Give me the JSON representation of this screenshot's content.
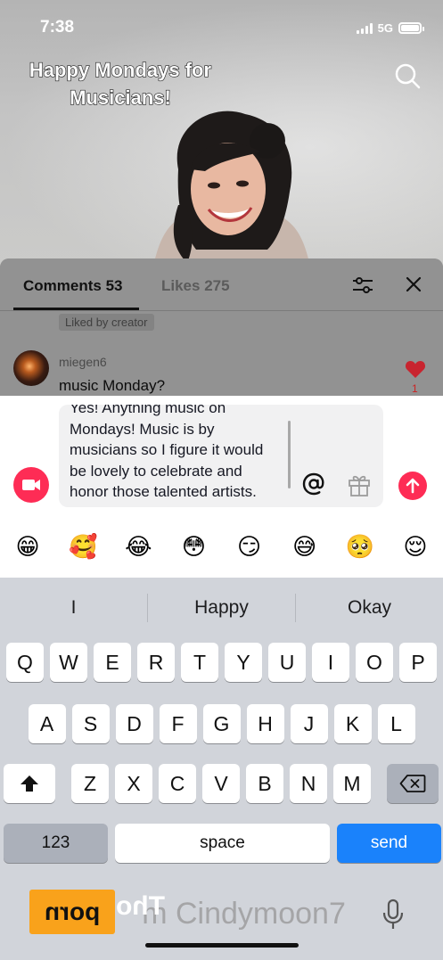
{
  "status": {
    "time": "7:38",
    "network": "5G"
  },
  "video": {
    "title_line1": "Happy Mondays for",
    "title_line2": "Musicians!"
  },
  "comments_sheet": {
    "tab_comments": "Comments 53",
    "tab_likes": "Likes 275",
    "liked_by_creator": "Liked by creator",
    "comment": {
      "username": "miegen6",
      "text": "music Monday?",
      "likes": "1"
    }
  },
  "composer": {
    "lines": [
      "Yes! Anything music on",
      "Mondays! Music is by",
      "musicians so I figure it would",
      "be lovely to celebrate and",
      "honor those talented artists."
    ]
  },
  "emojis": [
    "😁",
    "🥰",
    "😂",
    "😳",
    "😏",
    "😅",
    "🥺",
    "😌"
  ],
  "keyboard": {
    "suggestions": [
      "I",
      "Happy",
      "Okay"
    ],
    "row1": [
      "Q",
      "W",
      "E",
      "R",
      "T",
      "Y",
      "U",
      "I",
      "O",
      "P"
    ],
    "row2": [
      "A",
      "S",
      "D",
      "F",
      "G",
      "H",
      "J",
      "K",
      "L"
    ],
    "row3": [
      "Z",
      "X",
      "C",
      "V",
      "B",
      "N",
      "M"
    ],
    "key_123": "123",
    "key_space": "space",
    "key_send": "send"
  },
  "watermark": {
    "text": "m Cindymoon7",
    "logo": "porn",
    "logo_overlay": "Tho"
  },
  "colors": {
    "accent": "#fe2c55",
    "send_key": "#1a82fb"
  }
}
